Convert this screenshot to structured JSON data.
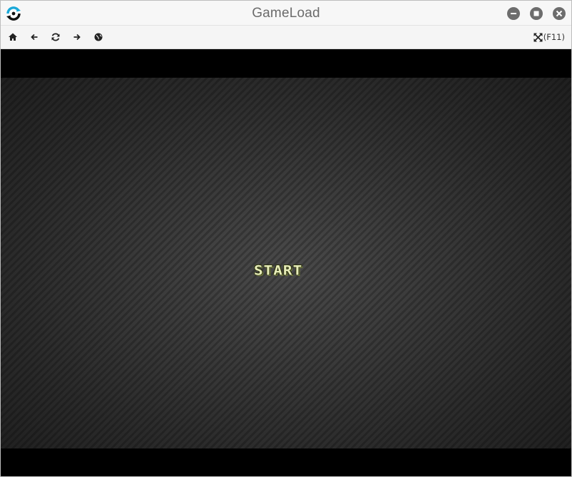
{
  "window": {
    "title": "GameLoad"
  },
  "titlebar": {
    "logo_icon": "gameload-logo-icon",
    "buttons": [
      {
        "name": "minimize-button",
        "icon": "minus-circle-icon"
      },
      {
        "name": "maximize-button",
        "icon": "stop-circle-icon"
      },
      {
        "name": "close-button",
        "icon": "close-circle-icon"
      }
    ]
  },
  "toolbar": {
    "buttons": [
      {
        "name": "home-button",
        "icon": "home-icon"
      },
      {
        "name": "back-button",
        "icon": "arrow-left-icon"
      },
      {
        "name": "reload-button",
        "icon": "refresh-icon"
      },
      {
        "name": "forward-button",
        "icon": "arrow-right-icon"
      },
      {
        "name": "globe-button",
        "icon": "globe-icon"
      }
    ],
    "fullscreen_label": "(F11)",
    "fullscreen_icon": "expand-arrows-icon"
  },
  "game": {
    "start_label": "START"
  },
  "colors": {
    "logo_accent": "#1aa8d8",
    "window_button": "#6d6d6d",
    "start_text": "#e7edb8"
  }
}
